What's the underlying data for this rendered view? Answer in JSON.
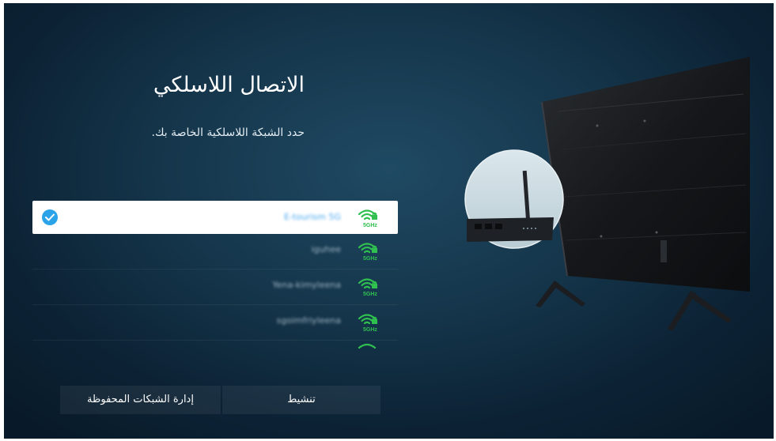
{
  "screen": {
    "title": "الاتصال اللاسلكي",
    "subtitle": "حدد الشبكة اللاسلكية الخاصة بك."
  },
  "networks": [
    {
      "name": "E-tourism 5G",
      "band": "5GHz",
      "selected": true
    },
    {
      "name": "iguhee",
      "band": "5GHz",
      "selected": false
    },
    {
      "name": "Yena-kimyleena",
      "band": "5GHz",
      "selected": false
    },
    {
      "name": "sgoimfriyleena",
      "band": "5GHz",
      "selected": false
    }
  ],
  "buttons": {
    "activate_label": "تنشيط",
    "manage_label": "إدارة الشبكات المحفوظة"
  },
  "icons": {
    "selected": "check-circle-icon",
    "network": "wifi-locked-icon"
  },
  "colors": {
    "accent": "#2aa3e8",
    "wifi_green": "#2fc04f",
    "background": "#143449"
  }
}
